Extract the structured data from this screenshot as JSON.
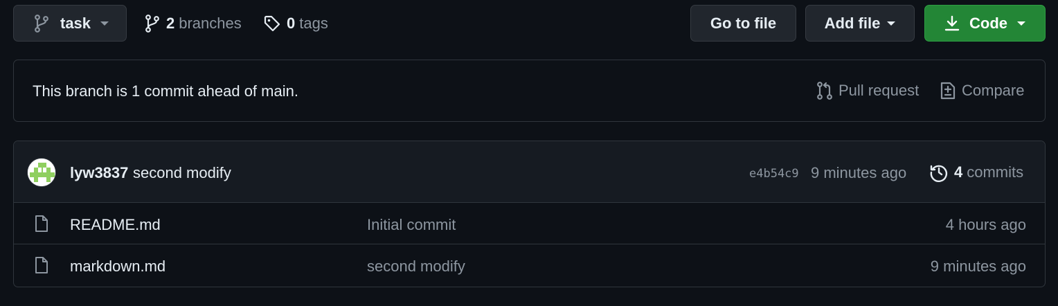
{
  "toolbar": {
    "branch_label": "task",
    "branches_count": "2",
    "branches_label": "branches",
    "tags_count": "0",
    "tags_label": "tags",
    "go_to_file_label": "Go to file",
    "add_file_label": "Add file",
    "code_label": "Code"
  },
  "banner": {
    "text": "This branch is 1 commit ahead of main.",
    "pull_request_label": "Pull request",
    "compare_label": "Compare"
  },
  "latest_commit": {
    "author": "lyw3837",
    "message": "second modify",
    "sha": "e4b54c9",
    "time": "9 minutes ago",
    "commits_count": "4",
    "commits_label": "commits"
  },
  "files": [
    {
      "name": "README.md",
      "commit": "Initial commit",
      "age": "4 hours ago",
      "icon": "file-icon"
    },
    {
      "name": "markdown.md",
      "commit": "second modify",
      "age": "9 minutes ago",
      "icon": "file-icon"
    }
  ],
  "colors": {
    "background": "#0d1117",
    "border": "#30363d",
    "button_bg": "#21262d",
    "primary_green": "#238636",
    "muted_text": "#8d96a0",
    "text": "#e6edf3",
    "avatar_green": "#8fcf5f"
  }
}
